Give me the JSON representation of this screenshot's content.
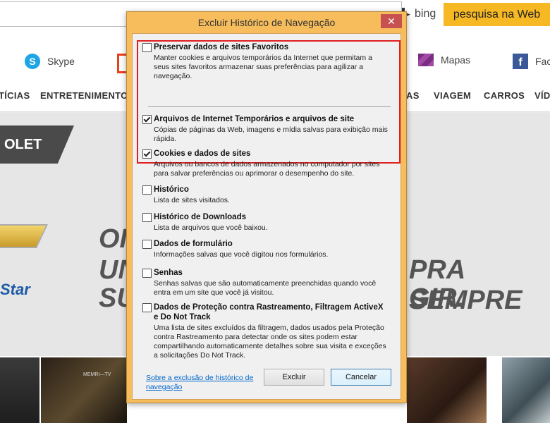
{
  "browser": {
    "bing_label": "bing",
    "search_button": "pesquisa na Web"
  },
  "apps": [
    {
      "label": "Skype",
      "icon": "skype-icon"
    },
    {
      "label": "",
      "icon": "office-icon"
    },
    {
      "label": "Mapas",
      "icon": "maps-icon"
    },
    {
      "label": "Face",
      "icon": "facebook-icon"
    }
  ],
  "nav": [
    "TÍCIAS",
    "ENTRETENIMENTO",
    "AS",
    "VIAGEM",
    "CARROS",
    "VÍD"
  ],
  "hero": {
    "badge": "OLET",
    "star_text": "Star",
    "line1": "OI",
    "line2a": "UN",
    "line2b": "PRA SEMPRE",
    "line3a": "SU",
    "line3b": "GIR."
  },
  "photo_caption": "MEMRI—TV",
  "dialog": {
    "title": "Excluir Histórico de Navegação",
    "close_label": "✕",
    "options": [
      {
        "title": "Preservar dados de sites Favoritos",
        "desc": "Manter cookies e arquivos temporários da Internet que permitam a seus sites favoritos armazenar suas preferências para agilizar a navegação.",
        "checked": false
      },
      {
        "title": "Arquivos de Internet Temporários e arquivos de site",
        "desc": "Cópias de páginas da Web, imagens e mídia salvas para exibição mais rápida.",
        "checked": true
      },
      {
        "title": "Cookies e dados de sites",
        "desc": "Arquivos ou bancos de dados armazenados no computador por sites para salvar preferências ou aprimorar o desempenho do site.",
        "checked": true
      },
      {
        "title": "Histórico",
        "desc": "Lista de sites visitados.",
        "checked": false
      },
      {
        "title": "Histórico de Downloads",
        "desc": "Lista de arquivos que você baixou.",
        "checked": false
      },
      {
        "title": "Dados de formulário",
        "desc": "Informações salvas que você digitou nos formulários.",
        "checked": false
      },
      {
        "title": "Senhas",
        "desc": "Senhas salvas que são automaticamente preenchidas quando você entra em um site que você já visitou.",
        "checked": false
      },
      {
        "title": "Dados de Proteção contra Rastreamento, Filtragem ActiveX e Do Not Track",
        "desc": "Uma lista de sites excluídos da filtragem, dados usados pela Proteção contra Rastreamento para detectar onde os sites podem estar compartilhando automaticamente detalhes sobre sua visita e exceções a solicitações Do Not Track.",
        "checked": false
      }
    ],
    "about_link": "Sobre a exclusão de histórico de navegação",
    "delete_button": "Excluir",
    "cancel_button": "Cancelar"
  }
}
